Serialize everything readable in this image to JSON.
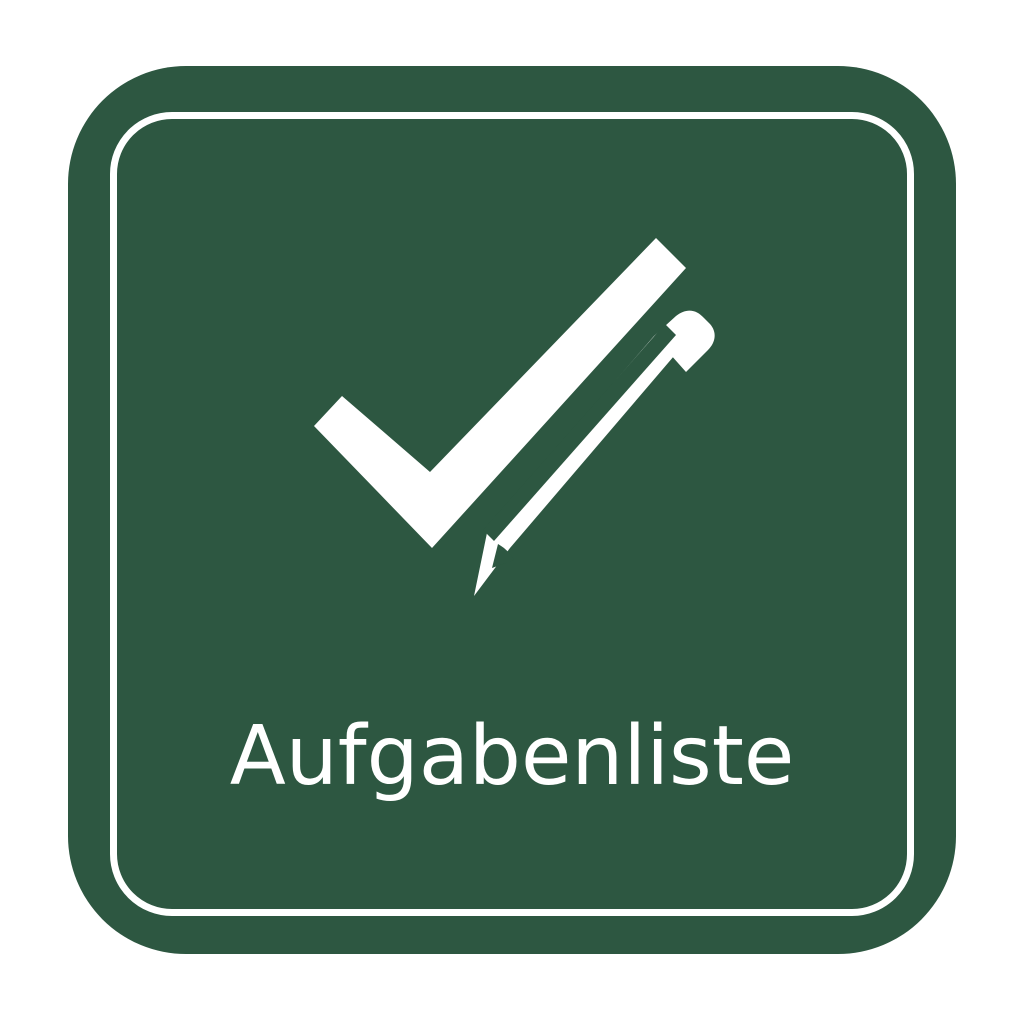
{
  "app_icon": {
    "label": "Aufgabenliste",
    "icons": [
      "check-icon",
      "pencil-icon"
    ],
    "colors": {
      "background": "#ffffff",
      "tile": "#2d5741",
      "foreground": "#ffffff"
    }
  }
}
